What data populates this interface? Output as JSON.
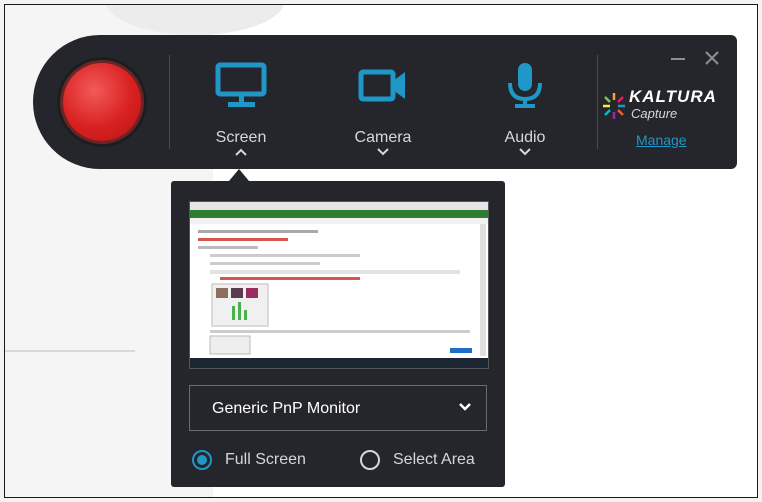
{
  "toolbar": {
    "sources": [
      {
        "label": "Screen",
        "icon": "monitor-icon",
        "expanded": true
      },
      {
        "label": "Camera",
        "icon": "video-camera-icon",
        "expanded": false
      },
      {
        "label": "Audio",
        "icon": "microphone-icon",
        "expanded": false
      }
    ],
    "brand": {
      "name": "KALTURA",
      "product": "Capture"
    },
    "manage_link": "Manage",
    "icons": {
      "minimize": "minimize-icon",
      "close": "close-icon"
    }
  },
  "panel": {
    "monitor_select": {
      "value": "Generic PnP Monitor"
    },
    "capture_mode": {
      "options": [
        "Full Screen",
        "Select Area"
      ],
      "selected": "Full Screen"
    }
  },
  "colors": {
    "toolbar_bg": "#25262b",
    "accent": "#1f97c7",
    "record": "#d92020",
    "text": "#d6d7db"
  }
}
